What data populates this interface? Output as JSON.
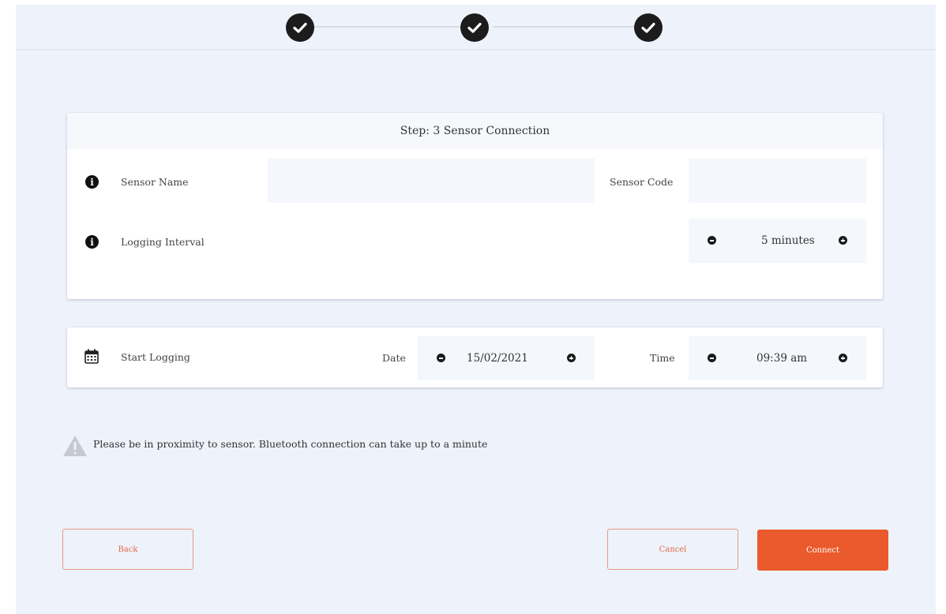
{
  "stepper": {
    "steps": [
      {
        "state": "completed",
        "icon": "check-icon"
      },
      {
        "state": "completed",
        "icon": "check-icon"
      },
      {
        "state": "completed",
        "icon": "check-icon"
      }
    ]
  },
  "sensor_card": {
    "title": "Step: 3 Sensor Connection",
    "sensor_name_label": "Sensor Name",
    "sensor_name_value": "",
    "sensor_code_label": "Sensor Code",
    "sensor_code_value": "",
    "logging_interval_label": "Logging Interval",
    "logging_interval_value": "5 minutes"
  },
  "start_card": {
    "label": "Start Logging",
    "date_label": "Date",
    "date_value": "15/02/2021",
    "time_label": "Time",
    "time_value": "09:39 am"
  },
  "warning": {
    "text": "Please be in proximity to sensor. Bluetooth connection can take up to a minute"
  },
  "buttons": {
    "back": "Back",
    "cancel": "Cancel",
    "connect": "Connect"
  },
  "colors": {
    "accent": "#ea5a2c",
    "background": "#eef2fb",
    "field": "#f4f7fc"
  }
}
